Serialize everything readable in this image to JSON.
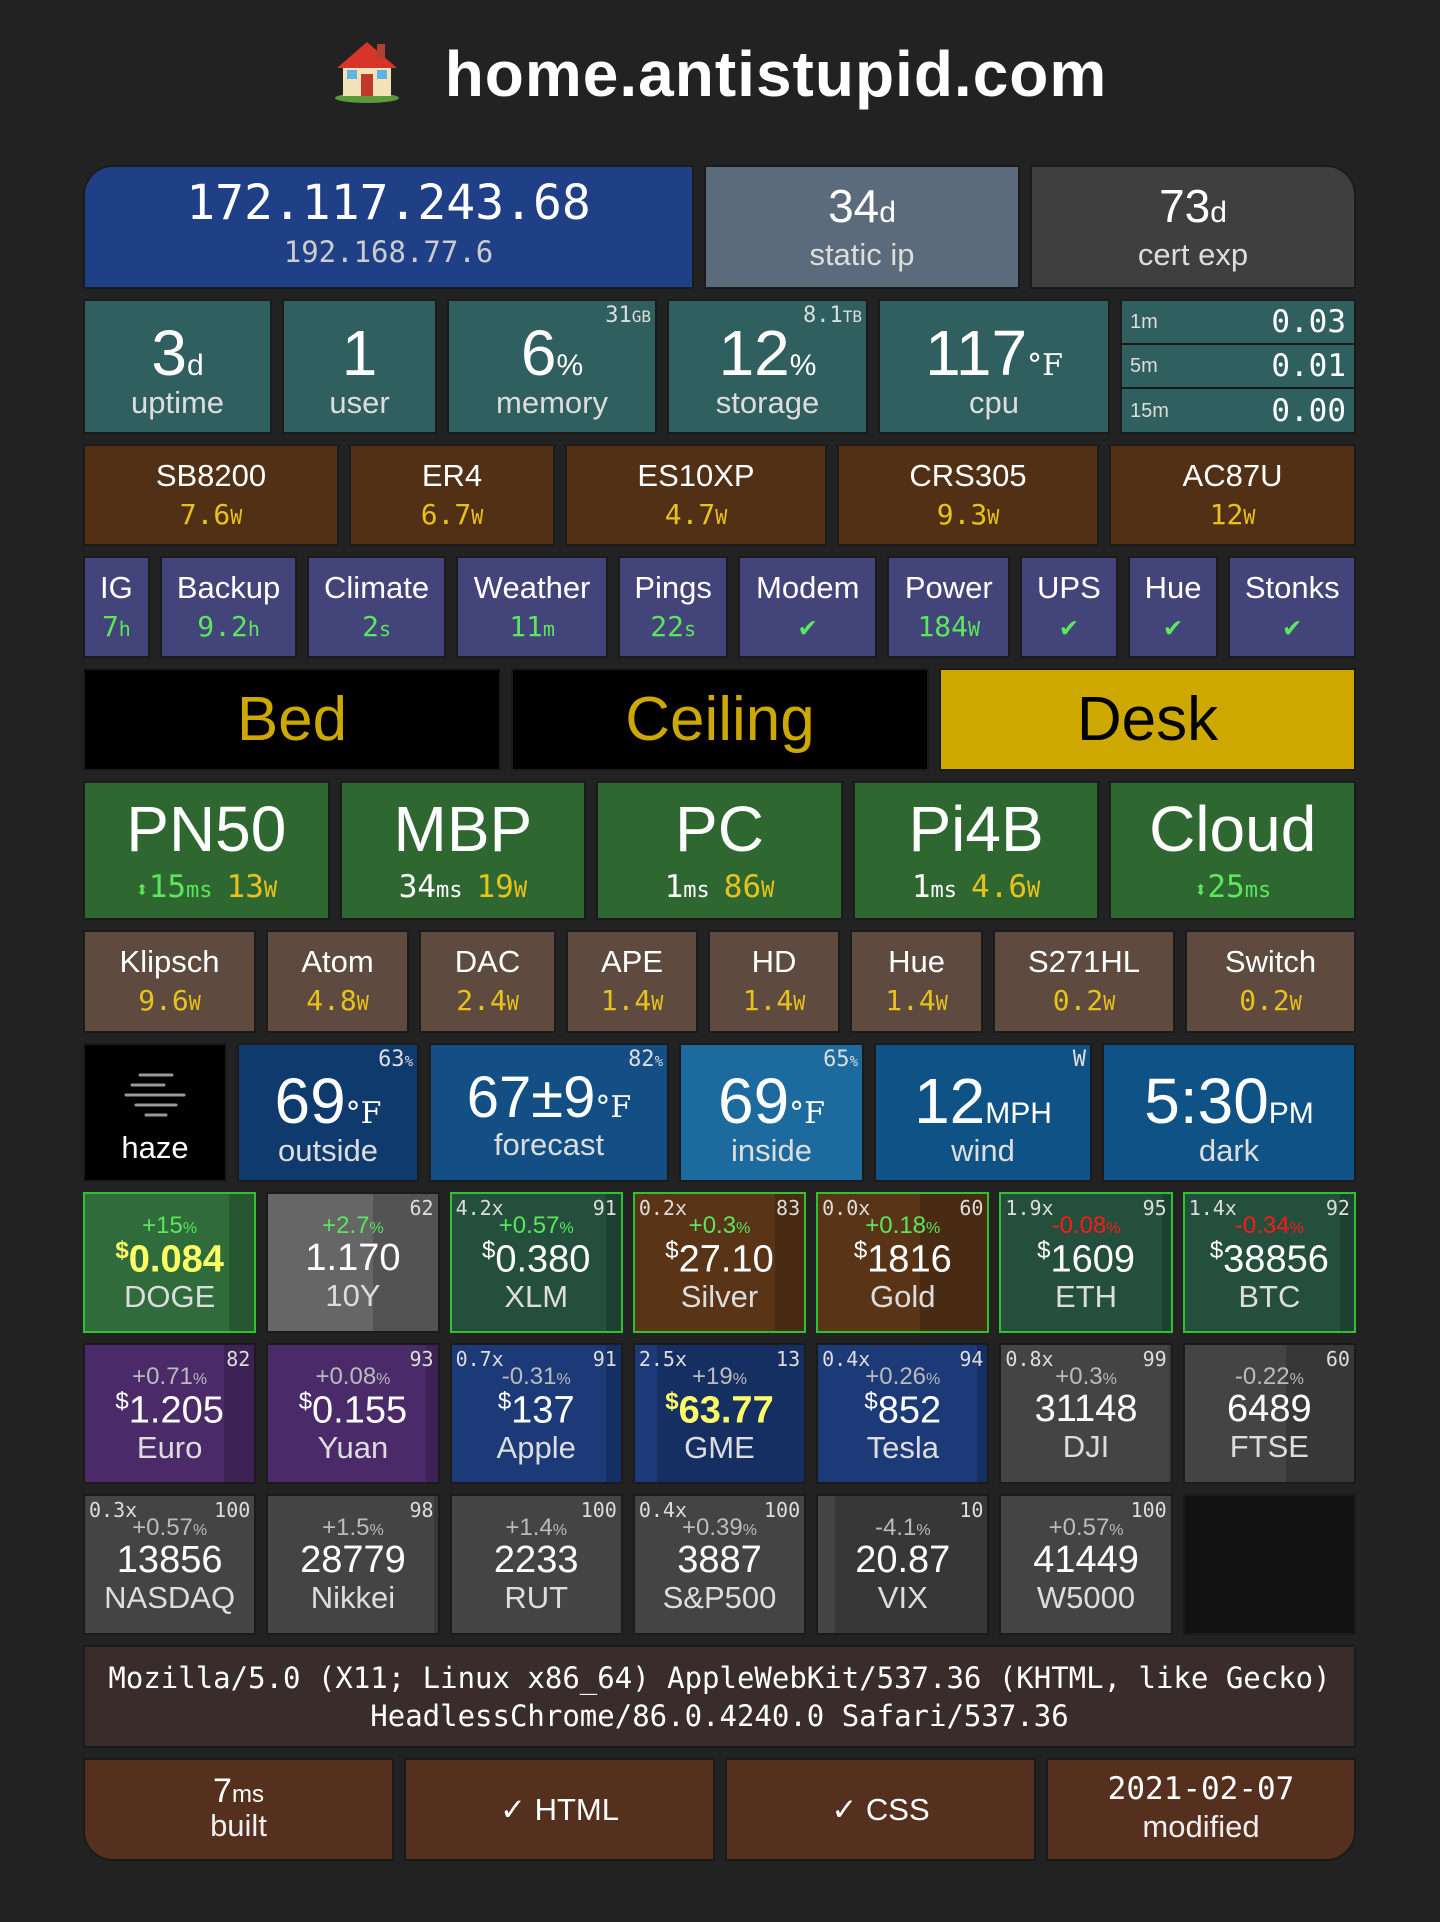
{
  "header": {
    "title": "home.antistupid.com",
    "icon": "house-icon"
  },
  "network": {
    "public_ip": "172.117.243.68",
    "local_ip": "192.168.77.6",
    "static_ip_days": "34",
    "static_ip_unit": "d",
    "static_ip_label": "static ip",
    "cert_days": "73",
    "cert_unit": "d",
    "cert_label": "cert exp"
  },
  "system": {
    "uptime_value": "3",
    "uptime_unit": "d",
    "uptime_label": "uptime",
    "users_value": "1",
    "users_label": "user",
    "memory_value": "6",
    "memory_unit": "%",
    "memory_label": "memory",
    "memory_total": "31",
    "memory_total_unit": "GB",
    "storage_value": "12",
    "storage_unit": "%",
    "storage_label": "storage",
    "storage_total": "8.1",
    "storage_total_unit": "TB",
    "cpu_value": "117",
    "cpu_unit": "°F",
    "cpu_label": "cpu",
    "load": [
      {
        "label": "1m",
        "value": "0.03"
      },
      {
        "label": "5m",
        "value": "0.01"
      },
      {
        "label": "15m",
        "value": "0.00"
      }
    ]
  },
  "network_devices": [
    {
      "name": "SB8200",
      "watts": "7.6",
      "unit": "W"
    },
    {
      "name": "ER4",
      "watts": "6.7",
      "unit": "W"
    },
    {
      "name": "ES10XP",
      "watts": "4.7",
      "unit": "W"
    },
    {
      "name": "CRS305",
      "watts": "9.3",
      "unit": "W"
    },
    {
      "name": "AC87U",
      "watts": "12",
      "unit": "W"
    }
  ],
  "services": [
    {
      "name": "IG",
      "value": "7",
      "unit": "h"
    },
    {
      "name": "Backup",
      "value": "9.2",
      "unit": "h"
    },
    {
      "name": "Climate",
      "value": "2",
      "unit": "s"
    },
    {
      "name": "Weather",
      "value": "11",
      "unit": "m"
    },
    {
      "name": "Pings",
      "value": "22",
      "unit": "s"
    },
    {
      "name": "Modem",
      "value": "✔",
      "unit": ""
    },
    {
      "name": "Power",
      "value": "184",
      "unit": "W"
    },
    {
      "name": "UPS",
      "value": "✔",
      "unit": ""
    },
    {
      "name": "Hue",
      "value": "✔",
      "unit": ""
    },
    {
      "name": "Stonks",
      "value": "✔",
      "unit": ""
    }
  ],
  "lights": [
    {
      "name": "Bed",
      "on": false
    },
    {
      "name": "Ceiling",
      "on": false
    },
    {
      "name": "Desk",
      "on": true
    }
  ],
  "hosts": [
    {
      "name": "PN50",
      "ping": "15",
      "ping_unit": "ms",
      "watts": "13",
      "watts_unit": "W",
      "arrow": "⬍"
    },
    {
      "name": "MBP",
      "ping": "34",
      "ping_unit": "ms",
      "watts": "19",
      "watts_unit": "W",
      "arrow": ""
    },
    {
      "name": "PC",
      "ping": "1",
      "ping_unit": "ms",
      "watts": "86",
      "watts_unit": "W",
      "arrow": ""
    },
    {
      "name": "Pi4B",
      "ping": "1",
      "ping_unit": "ms",
      "watts": "4.6",
      "watts_unit": "W",
      "arrow": ""
    },
    {
      "name": "Cloud",
      "ping": "25",
      "ping_unit": "ms",
      "watts": "",
      "watts_unit": "",
      "arrow": "⬍"
    }
  ],
  "peripherals": [
    {
      "name": "Klipsch",
      "watts": "9.6",
      "unit": "W"
    },
    {
      "name": "Atom",
      "watts": "4.8",
      "unit": "W"
    },
    {
      "name": "DAC",
      "watts": "2.4",
      "unit": "W"
    },
    {
      "name": "APE",
      "watts": "1.4",
      "unit": "W"
    },
    {
      "name": "HD",
      "watts": "1.4",
      "unit": "W"
    },
    {
      "name": "Hue",
      "watts": "1.4",
      "unit": "W"
    },
    {
      "name": "S271HL",
      "watts": "0.2",
      "unit": "W"
    },
    {
      "name": "Switch",
      "watts": "0.2",
      "unit": "W"
    }
  ],
  "weather": {
    "condition": "haze",
    "condition_icon": "haze-icon",
    "outside": {
      "value": "69",
      "unit": "°F",
      "label": "outside",
      "humidity": "63",
      "humidity_unit": "%"
    },
    "forecast": {
      "value": "67±9",
      "unit": "°F",
      "label": "forecast",
      "humidity": "82",
      "humidity_unit": "%"
    },
    "inside": {
      "value": "69",
      "unit": "°F",
      "label": "inside",
      "humidity": "65",
      "humidity_unit": "%"
    },
    "wind": {
      "value": "12",
      "unit": "MPH",
      "label": "wind",
      "direction": "W"
    },
    "time": {
      "value": "5:30",
      "unit": "PM",
      "label": "dark"
    }
  },
  "tickers_row1": [
    {
      "name": "DOGE",
      "pct": "+15",
      "cur": "$",
      "val": "0.084",
      "mult": "",
      "rank": "",
      "bg": "#2f6b3b",
      "border": "#30c030",
      "pct_color": "#5ce65c",
      "val_color": "#ffff66",
      "bold": true,
      "fill": 0.85
    },
    {
      "name": "10Y",
      "pct": "+2.7",
      "cur": "",
      "val": "1.170",
      "mult": "",
      "rank": "62",
      "bg": "#666666",
      "border": "#1b1b1b",
      "pct_color": "#5ce65c",
      "val_color": "#ffffff",
      "bold": false,
      "fill": 0.62
    },
    {
      "name": "XLM",
      "pct": "+0.57",
      "cur": "$",
      "val": "0.380",
      "mult": "4.2x",
      "rank": "91",
      "bg": "#234f3c",
      "border": "#30c030",
      "pct_color": "#5ce65c",
      "val_color": "#ffffff",
      "bold": false,
      "fill": 0.91
    },
    {
      "name": "Silver",
      "pct": "+0.3",
      "cur": "$",
      "val": "27.10",
      "mult": "0.2x",
      "rank": "83",
      "bg": "#5a3416",
      "border": "#30c030",
      "pct_color": "#5ce65c",
      "val_color": "#ffffff",
      "bold": false,
      "fill": 0.83
    },
    {
      "name": "Gold",
      "pct": "+0.18",
      "cur": "$",
      "val": "1816",
      "mult": "0.0x",
      "rank": "60",
      "bg": "#5a3416",
      "border": "#30c030",
      "pct_color": "#5ce65c",
      "val_color": "#ffffff",
      "bold": false,
      "fill": 0.6
    },
    {
      "name": "ETH",
      "pct": "-0.08",
      "cur": "$",
      "val": "1609",
      "mult": "1.9x",
      "rank": "95",
      "bg": "#234f3c",
      "border": "#30c030",
      "pct_color": "#ff1a1a",
      "val_color": "#ffffff",
      "bold": false,
      "fill": 0.95
    },
    {
      "name": "BTC",
      "pct": "-0.34",
      "cur": "$",
      "val": "38856",
      "mult": "1.4x",
      "rank": "92",
      "bg": "#234f3c",
      "border": "#30c030",
      "pct_color": "#ff1a1a",
      "val_color": "#ffffff",
      "bold": false,
      "fill": 0.92
    }
  ],
  "tickers_row2": [
    {
      "name": "Euro",
      "pct": "+0.71",
      "cur": "$",
      "val": "1.205",
      "mult": "",
      "rank": "82",
      "bg": "#4a2a68",
      "border": "#1b1b1b",
      "pct_color": "#bbbbbb",
      "val_color": "#ffffff",
      "bold": false,
      "fill": 0.82
    },
    {
      "name": "Yuan",
      "pct": "+0.08",
      "cur": "$",
      "val": "0.155",
      "mult": "",
      "rank": "93",
      "bg": "#4a2a68",
      "border": "#1b1b1b",
      "pct_color": "#bbbbbb",
      "val_color": "#ffffff",
      "bold": false,
      "fill": 0.93
    },
    {
      "name": "Apple",
      "pct": "-0.31",
      "cur": "$",
      "val": "137",
      "mult": "0.7x",
      "rank": "91",
      "bg": "#1c3a78",
      "border": "#1b1b1b",
      "pct_color": "#bbbbbb",
      "val_color": "#ffffff",
      "bold": false,
      "fill": 0.91
    },
    {
      "name": "GME",
      "pct": "+19",
      "cur": "$",
      "val": "63.77",
      "mult": "2.5x",
      "rank": "13",
      "bg": "#1c3a78",
      "border": "#1b1b1b",
      "pct_color": "#bbbbbb",
      "val_color": "#ffff66",
      "bold": true,
      "fill": 0.13
    },
    {
      "name": "Tesla",
      "pct": "+0.26",
      "cur": "$",
      "val": "852",
      "mult": "0.4x",
      "rank": "94",
      "bg": "#1c3a78",
      "border": "#1b1b1b",
      "pct_color": "#bbbbbb",
      "val_color": "#ffffff",
      "bold": false,
      "fill": 0.94
    },
    {
      "name": "DJI",
      "pct": "+0.3",
      "cur": "",
      "val": "31148",
      "mult": "0.8x",
      "rank": "99",
      "bg": "#444444",
      "border": "#1b1b1b",
      "pct_color": "#bbbbbb",
      "val_color": "#ffffff",
      "bold": false,
      "fill": 0.99
    },
    {
      "name": "FTSE",
      "pct": "-0.22",
      "cur": "",
      "val": "6489",
      "mult": "",
      "rank": "60",
      "bg": "#444444",
      "border": "#1b1b1b",
      "pct_color": "#bbbbbb",
      "val_color": "#ffffff",
      "bold": false,
      "fill": 0.6
    }
  ],
  "tickers_row3": [
    {
      "name": "NASDAQ",
      "pct": "+0.57",
      "cur": "",
      "val": "13856",
      "mult": "0.3x",
      "rank": "100",
      "bg": "#444444",
      "border": "#1b1b1b",
      "pct_color": "#bbbbbb",
      "val_color": "#ffffff",
      "bold": false,
      "fill": 1
    },
    {
      "name": "Nikkei",
      "pct": "+1.5",
      "cur": "",
      "val": "28779",
      "mult": "",
      "rank": "98",
      "bg": "#444444",
      "border": "#1b1b1b",
      "pct_color": "#bbbbbb",
      "val_color": "#ffffff",
      "bold": false,
      "fill": 0.98
    },
    {
      "name": "RUT",
      "pct": "+1.4",
      "cur": "",
      "val": "2233",
      "mult": "",
      "rank": "100",
      "bg": "#444444",
      "border": "#1b1b1b",
      "pct_color": "#bbbbbb",
      "val_color": "#ffffff",
      "bold": false,
      "fill": 1
    },
    {
      "name": "S&P500",
      "pct": "+0.39",
      "cur": "",
      "val": "3887",
      "mult": "0.4x",
      "rank": "100",
      "bg": "#444444",
      "border": "#1b1b1b",
      "pct_color": "#bbbbbb",
      "val_color": "#ffffff",
      "bold": false,
      "fill": 1
    },
    {
      "name": "VIX",
      "pct": "-4.1",
      "cur": "",
      "val": "20.87",
      "mult": "",
      "rank": "10",
      "bg": "#444444",
      "border": "#1b1b1b",
      "pct_color": "#bbbbbb",
      "val_color": "#ffffff",
      "bold": false,
      "fill": 0.1
    },
    {
      "name": "W5000",
      "pct": "+0.57",
      "cur": "",
      "val": "41449",
      "mult": "",
      "rank": "100",
      "bg": "#444444",
      "border": "#1b1b1b",
      "pct_color": "#bbbbbb",
      "val_color": "#ffffff",
      "bold": false,
      "fill": 1
    }
  ],
  "pct_unit": "%",
  "user_agent": "Mozilla/5.0 (X11; Linux x86_64) AppleWebKit/537.36 (KHTML, like Gecko) HeadlessChrome/86.0.4240.0 Safari/537.36",
  "footer": {
    "built_value": "7",
    "built_unit": "ms",
    "built_label": "built",
    "html_label": "✓ HTML",
    "css_label": "✓ CSS",
    "modified_date": "2021-02-07",
    "modified_label": "modified"
  },
  "colors": {
    "light_on": "#cda800",
    "light_off_text": "#cda800",
    "light_on_text": "#000000"
  }
}
